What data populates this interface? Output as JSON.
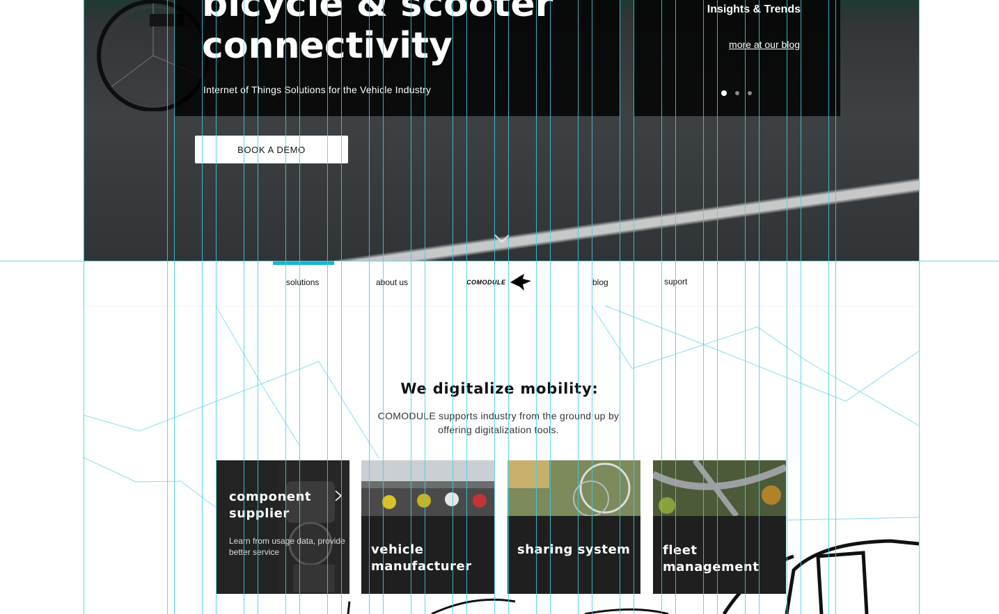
{
  "hero": {
    "title": "bicycle & scooter connectivity",
    "subtitle": "Internet of Things Solutions for the Vehicle Industry",
    "cta_label": "BOOK A DEMO",
    "insights_heading": "Insights & Trends",
    "blog_link": "more at our blog",
    "slider_dots": 3,
    "active_dot": 0
  },
  "nav": {
    "items": [
      {
        "label": "solutions",
        "active": true
      },
      {
        "label": "about us",
        "active": false
      },
      {
        "label": "blog",
        "active": false
      },
      {
        "label": "suport",
        "active": false
      }
    ],
    "logo_text": "COMODULE",
    "accent_color": "#18b6d6"
  },
  "main": {
    "title": "We digitalize mobility:",
    "description": "COMODULE supports industry from the ground up by offering digitalization tools.",
    "cards": [
      {
        "title": "component supplier",
        "description": "Learn from usage data, provide better service"
      },
      {
        "title": "vehicle manufacturer"
      },
      {
        "title": "sharing system"
      },
      {
        "title": "fleet management"
      }
    ]
  },
  "colors": {
    "guide_lines": "#3fd0e6",
    "dark_panel": "#000000",
    "card_dark": "#1f1f1f"
  }
}
